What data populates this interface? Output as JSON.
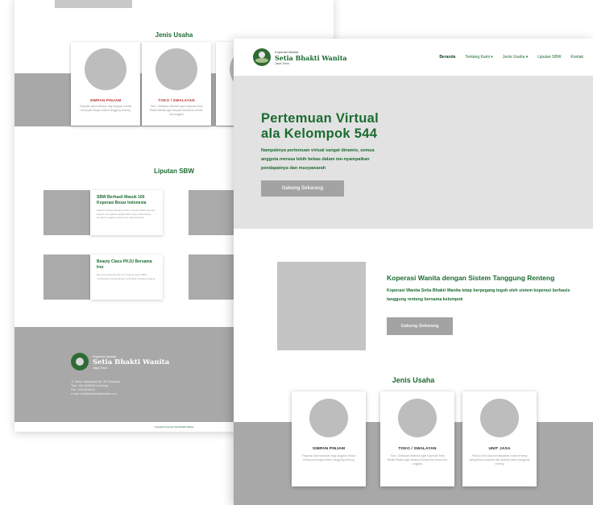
{
  "back_page": {
    "jenis_usaha": {
      "title": "Jenis Usaha",
      "cards": [
        {
          "title": "SIMPAN PINJAM",
          "desc": "Pinjaman diperuntukkan bagi anggota melalui kelompok dengan sistem tanggung renteng"
        },
        {
          "title": "TOKO / SWALAYAN",
          "desc": "Toko / Swalayan dibentuk agar Koperasi Setia Bhakti Wanita juga melayani kebutuhan sehari-hari anggota"
        },
        {
          "title": "",
          "desc": ""
        }
      ]
    },
    "liputan": {
      "title": "Liputan SBW",
      "items": [
        {
          "title": "SBW Berhasil Masuk 100 Koperasi Besar Indonesia",
          "desc": "Wadah berbagi peluang usaha, sebuah SBW Koperasi Wanita merupakan wadah 2021 tetap berkembang bersama anggota untuk terus maju bersama"
        },
        {
          "title": "Beauty Class PKJU Bersama Irez",
          "desc": "Bersama koperasi dan irez bekerja sama SBW memberikan pengetahuan kecantikan kepada anggota"
        }
      ]
    },
    "footer": {
      "logo_small": "Koperasi Wanita",
      "logo_big": "Setia Bhakti Wanita",
      "logo_region": "Jawa Timur",
      "address": [
        "Jl. Jemur Handayani No. 55 Surabaya",
        "Telp : 031-8436802 (hunting)",
        "Fax : 031-8436410",
        "e-mail: info@setiabhaktiwanita.com"
      ],
      "copyright": "Copyright Koperasi Setia Bhakti Wanita"
    }
  },
  "front_page": {
    "nav": {
      "logo_small": "Koperasi Wanita",
      "logo_big": "Setia Bhakti Wanita",
      "logo_region": "Jawa Timur",
      "menu": [
        "Beranda",
        "Tentang Kami ▾",
        "Jenis Usaha ▾",
        "Liputan SBW",
        "Kontak"
      ]
    },
    "hero": {
      "title_line1": "Pertemuan Virtual",
      "title_line2": "ala Kelompok 544",
      "desc": "Nampaknya pertemuan virtual sangat dinamis, semua anggota merasa lebih bebas dalam me-nyampaikan pendapatnya dan musyawarah",
      "button": "Gabung Sekarang"
    },
    "about": {
      "title": "Koperasi Wanita dengan Sistem Tanggung Renteng",
      "desc": "Koperasi Wanita Setia Bhakti Wanita tetap berpegang teguh oleh sistem koperasi berbasis tanggung renteng bersama kelompok",
      "button": "Gabung Sekarang"
    },
    "jenis_usaha": {
      "title": "Jenis Usaha",
      "cards": [
        {
          "title": "SIMPAN PINJAM",
          "desc": "Pinjaman diperuntukkan bagi anggota melalui kelompok dengan sistem tanggung renteng"
        },
        {
          "title": "TOKO / SWALAYAN",
          "desc": "Toko / Swalayan dibentuk agar Koperasi Setia Bhakti Wanita juga melayani kebutuhan sehari-hari anggota"
        },
        {
          "title": "UNIT JASA",
          "desc": "Pesona Unit Jasa mendapatkan materi tentang pengelolaan koperasi dan aplikasi sistem tanggung renteng"
        }
      ]
    }
  }
}
